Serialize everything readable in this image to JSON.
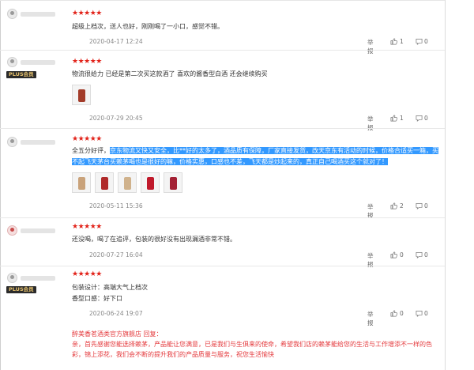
{
  "colors": {
    "star": "#e2231a",
    "highlight": "#3399ff",
    "reply": "#e4393c",
    "plus_badge_bg": "#2b2b2b"
  },
  "actions": {
    "report": "举报"
  },
  "icons": {
    "star": "★★★★★",
    "thumb": "thumbs-up-icon",
    "comment": "comment-icon"
  },
  "reviews": [
    {
      "stars": "★★★★★",
      "text": "超级上档次，送人也好，刚刚喝了一小口，感觉不错。",
      "date": "2020-04-17 12:24",
      "likes": "1",
      "comments": "0"
    },
    {
      "stars": "★★★★★",
      "plus": "PLUS会员",
      "text": "物流很给力 已经是第二次买这款酒了 喜欢的酱香型白酒 还会继续购买",
      "date": "2020-07-29 20:45",
      "likes": "1",
      "comments": "0"
    },
    {
      "stars": "★★★★★",
      "line1_pre": "全五分好评，",
      "line1_hl": "京东物流又快又安全，比**好的太多了，酒品质有保障，厂家直接发货，改天京东有活动的时候，价格合适买一箱，买",
      "line2_hl": "不起飞天茅台买赖茅喝也是很好的嘛，价格实惠，口感也不差，飞天都是炒起来的，真正自己喝酒买这个就对了！",
      "date": "2020-05-11 15:36",
      "likes": "2",
      "comments": "0"
    },
    {
      "stars": "★★★★★",
      "text": "还没喝，喝了在追评，包装的很好没有出现漏酒非常不错。",
      "date": "2020-07-27 16:04",
      "likes": "0",
      "comments": "0"
    },
    {
      "stars": "★★★★★",
      "plus": "PLUS会员",
      "line1": "包装设计：高端大气上档次",
      "line2": "香型口感：好下口",
      "date": "2020-06-24 19:07",
      "likes": "0",
      "comments": "0",
      "reply": {
        "head": "醉美香茗酒类官方旗舰店 回复：",
        "line1": "亲，首先感谢您能选择赖茅，产品能让您满意，已是我们与生俱来的使命，希望我们店的赖茅能给您的生活与工作增添不一样的色",
        "line2": "彩，锦上添花，我们会不断的提升我们的产品质量与服务，祝您生活愉快"
      }
    }
  ]
}
